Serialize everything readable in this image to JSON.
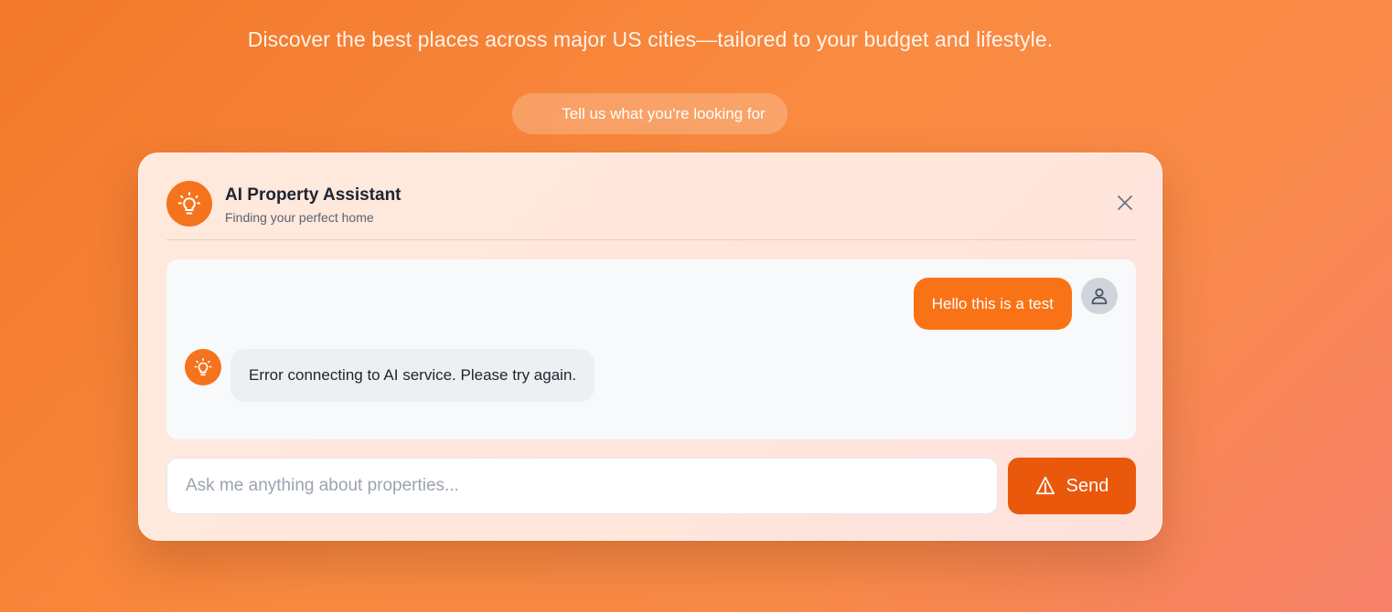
{
  "hero": {
    "subtitle": "Discover the best places across major US cities—tailored to your budget and lifestyle.",
    "pill_label": "Tell us what you're looking for"
  },
  "assistant": {
    "title": "AI Property Assistant",
    "subtitle": "Finding your perfect home",
    "close_icon": "close-icon",
    "avatar_icon": "lightbulb-icon"
  },
  "chat": {
    "messages": [
      {
        "role": "user",
        "text": "Hello this is a test"
      },
      {
        "role": "assistant",
        "text": "Error connecting to AI service. Please try again."
      }
    ]
  },
  "composer": {
    "placeholder": "Ask me anything about properties...",
    "value": "",
    "send_label": "Send",
    "send_icon": "send-icon"
  },
  "colors": {
    "accent": "#f97316",
    "send_button": "#ea580c",
    "background_start": "#f2782a",
    "background_end": "#f6806a"
  }
}
